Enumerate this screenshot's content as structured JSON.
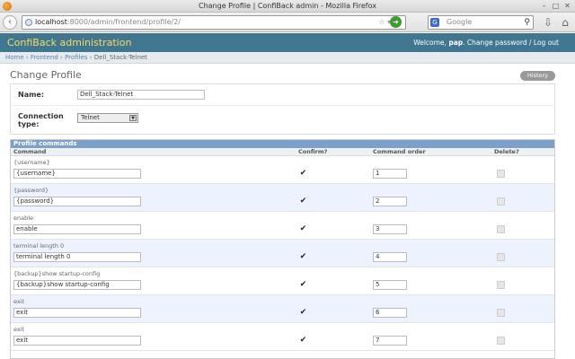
{
  "window": {
    "title": "Change Profile | ConfiBack admin - Mozilla Firefox"
  },
  "browser": {
    "url_host": "localhost",
    "url_path": ":8000/admin/frontend/profile/2/",
    "search_engine": "Google"
  },
  "header": {
    "brand": "ConfiBack administration",
    "welcome": "Welcome,",
    "user": "pap",
    "links": "Change password / Log out"
  },
  "breadcrumbs": [
    "Home",
    "Frontend",
    "Profiles",
    "Dell_Stack-Telnet"
  ],
  "page": {
    "title": "Change Profile",
    "history_label": "History",
    "name_label": "Name:",
    "name_value": "Dell_Stack-Telnet",
    "connection_label_1": "Connection",
    "connection_label_2": "type:",
    "connection_value": "Telnet"
  },
  "inline": {
    "caption": "Profile commands",
    "col_command": "Command",
    "col_confirm": "Confirm?",
    "col_order": "Command order",
    "col_delete": "Delete?",
    "rows": [
      {
        "original": "{username}",
        "command": "{username}",
        "confirm": true,
        "order": "1"
      },
      {
        "original": "{password}",
        "command": "{password}",
        "confirm": true,
        "order": "2"
      },
      {
        "original": "enable",
        "command": "enable",
        "confirm": true,
        "order": "3"
      },
      {
        "original": "terminal length 0",
        "command": "terminal length 0",
        "confirm": true,
        "order": "4"
      },
      {
        "original": "{backup}show startup-config",
        "command": "{backup}show startup-config",
        "confirm": true,
        "order": "5"
      },
      {
        "original": "exit",
        "command": "exit",
        "confirm": true,
        "order": "6"
      },
      {
        "original": "exit",
        "command": "exit",
        "confirm": true,
        "order": "7"
      }
    ]
  },
  "colors": {
    "header_bg": "#417690",
    "brand": "#f5dd5d",
    "caption_bg": "#7ca0c7",
    "alt_row": "#edf3fe"
  },
  "icons": [
    "firefox-icon",
    "back-icon",
    "globe-icon",
    "bookmark-star-icon",
    "go-icon",
    "google-icon",
    "search-icon",
    "download-icon",
    "home-icon",
    "checkmark-icon"
  ]
}
